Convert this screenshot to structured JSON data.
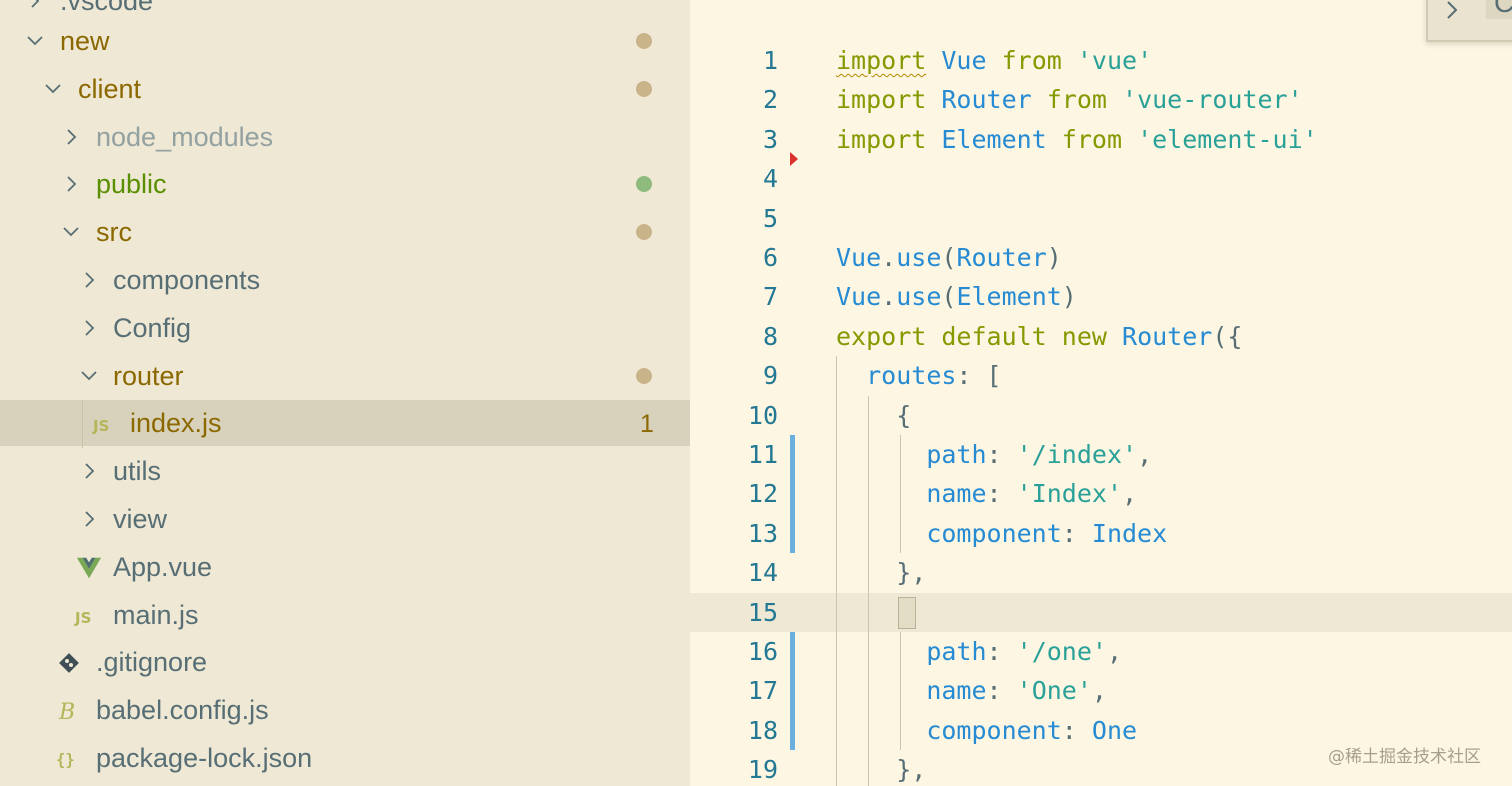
{
  "explorer": {
    "top_partial_label": ".vscode",
    "items": [
      {
        "label": "new",
        "color": "#8b6800",
        "expanded": true,
        "dot": "#c9b48a"
      },
      {
        "label": "client",
        "color": "#8b6800",
        "expanded": true,
        "dot": "#c9b48a"
      },
      {
        "label": "node_modules",
        "color": "#93a1a1",
        "expanded": false
      },
      {
        "label": "public",
        "color": "#5a8f00",
        "expanded": false,
        "dot": "#8fba7e"
      },
      {
        "label": "src",
        "color": "#8b6800",
        "expanded": true,
        "dot": "#c9b48a"
      },
      {
        "label": "components",
        "color": "#586e75",
        "expanded": false
      },
      {
        "label": "Config",
        "color": "#586e75",
        "expanded": false
      },
      {
        "label": "router",
        "color": "#8b6800",
        "expanded": true,
        "dot": "#c9b48a"
      },
      {
        "label": "index.js",
        "color": "#8b6800",
        "icon": "js-file-icon",
        "count": "1",
        "selected": true
      },
      {
        "label": "utils",
        "color": "#586e75",
        "expanded": false
      },
      {
        "label": "view",
        "color": "#586e75",
        "expanded": false
      },
      {
        "label": "App.vue",
        "color": "#586e75",
        "icon": "vue-file-icon"
      },
      {
        "label": "main.js",
        "color": "#586e75",
        "icon": "js-file-icon"
      },
      {
        "label": ".gitignore",
        "color": "#586e75",
        "icon": "git-icon"
      },
      {
        "label": "babel.config.js",
        "color": "#586e75",
        "icon": "babel-icon"
      },
      {
        "label": "package-lock.json",
        "color": "#586e75",
        "icon": "json-icon"
      }
    ]
  },
  "editor": {
    "current_line": 15,
    "lines": [
      {
        "n": "1",
        "tokens": [
          {
            "t": "import",
            "c": "kw squig"
          },
          {
            "t": " ",
            "c": "pl"
          },
          {
            "t": "Vue",
            "c": "id"
          },
          {
            "t": " ",
            "c": "pl"
          },
          {
            "t": "from",
            "c": "kw"
          },
          {
            "t": " ",
            "c": "pl"
          },
          {
            "t": "'vue'",
            "c": "str"
          }
        ]
      },
      {
        "n": "2",
        "tokens": [
          {
            "t": "import",
            "c": "kw"
          },
          {
            "t": " ",
            "c": "pl"
          },
          {
            "t": "Router",
            "c": "id"
          },
          {
            "t": " ",
            "c": "pl"
          },
          {
            "t": "from",
            "c": "kw"
          },
          {
            "t": " ",
            "c": "pl"
          },
          {
            "t": "'vue-router'",
            "c": "str"
          }
        ]
      },
      {
        "n": "3",
        "tokens": [
          {
            "t": "import",
            "c": "kw"
          },
          {
            "t": " ",
            "c": "pl"
          },
          {
            "t": "Element",
            "c": "id"
          },
          {
            "t": " ",
            "c": "pl"
          },
          {
            "t": "from",
            "c": "kw"
          },
          {
            "t": " ",
            "c": "pl"
          },
          {
            "t": "'element-ui'",
            "c": "str"
          }
        ]
      },
      {
        "n": "4",
        "tokens": []
      },
      {
        "n": "5",
        "tokens": []
      },
      {
        "n": "6",
        "tokens": [
          {
            "t": "Vue",
            "c": "id"
          },
          {
            "t": ".",
            "c": "pl"
          },
          {
            "t": "use",
            "c": "id"
          },
          {
            "t": "(",
            "c": "pl"
          },
          {
            "t": "Router",
            "c": "id"
          },
          {
            "t": ")",
            "c": "pl"
          }
        ]
      },
      {
        "n": "7",
        "tokens": [
          {
            "t": "Vue",
            "c": "id"
          },
          {
            "t": ".",
            "c": "pl"
          },
          {
            "t": "use",
            "c": "id"
          },
          {
            "t": "(",
            "c": "pl"
          },
          {
            "t": "Element",
            "c": "id"
          },
          {
            "t": ")",
            "c": "pl"
          }
        ]
      },
      {
        "n": "8",
        "tokens": [
          {
            "t": "export",
            "c": "kw"
          },
          {
            "t": " ",
            "c": "pl"
          },
          {
            "t": "default",
            "c": "kw"
          },
          {
            "t": " ",
            "c": "pl"
          },
          {
            "t": "new",
            "c": "kw"
          },
          {
            "t": " ",
            "c": "pl"
          },
          {
            "t": "Router",
            "c": "id"
          },
          {
            "t": "({",
            "c": "pl"
          }
        ]
      },
      {
        "n": "9",
        "tokens": [
          {
            "t": "  ",
            "c": "pl"
          },
          {
            "t": "routes",
            "c": "id"
          },
          {
            "t": ": [",
            "c": "pl"
          }
        ]
      },
      {
        "n": "10",
        "tokens": [
          {
            "t": "    {",
            "c": "pl"
          }
        ]
      },
      {
        "n": "11",
        "tokens": [
          {
            "t": "      ",
            "c": "pl"
          },
          {
            "t": "path",
            "c": "id"
          },
          {
            "t": ": ",
            "c": "pl"
          },
          {
            "t": "'/index'",
            "c": "str"
          },
          {
            "t": ",",
            "c": "pl"
          }
        ]
      },
      {
        "n": "12",
        "tokens": [
          {
            "t": "      ",
            "c": "pl"
          },
          {
            "t": "name",
            "c": "id"
          },
          {
            "t": ": ",
            "c": "pl"
          },
          {
            "t": "'Index'",
            "c": "str"
          },
          {
            "t": ",",
            "c": "pl"
          }
        ]
      },
      {
        "n": "13",
        "tokens": [
          {
            "t": "      ",
            "c": "pl"
          },
          {
            "t": "component",
            "c": "id"
          },
          {
            "t": ": ",
            "c": "pl"
          },
          {
            "t": "Index",
            "c": "id"
          }
        ]
      },
      {
        "n": "14",
        "tokens": [
          {
            "t": "    },",
            "c": "pl"
          }
        ]
      },
      {
        "n": "15",
        "tokens": [
          {
            "t": "    {",
            "c": "pl"
          }
        ]
      },
      {
        "n": "16",
        "tokens": [
          {
            "t": "      ",
            "c": "pl"
          },
          {
            "t": "path",
            "c": "id"
          },
          {
            "t": ": ",
            "c": "pl"
          },
          {
            "t": "'/one'",
            "c": "str"
          },
          {
            "t": ",",
            "c": "pl"
          }
        ]
      },
      {
        "n": "17",
        "tokens": [
          {
            "t": "      ",
            "c": "pl"
          },
          {
            "t": "name",
            "c": "id"
          },
          {
            "t": ": ",
            "c": "pl"
          },
          {
            "t": "'One'",
            "c": "str"
          },
          {
            "t": ",",
            "c": "pl"
          }
        ]
      },
      {
        "n": "18",
        "tokens": [
          {
            "t": "      ",
            "c": "pl"
          },
          {
            "t": "component",
            "c": "id"
          },
          {
            "t": ": ",
            "c": "pl"
          },
          {
            "t": "One",
            "c": "id"
          }
        ]
      },
      {
        "n": "19",
        "tokens": [
          {
            "t": "    },",
            "c": "pl"
          }
        ]
      }
    ]
  },
  "peek": {
    "text": "Co"
  },
  "watermark": "@稀土掘金技术社区"
}
